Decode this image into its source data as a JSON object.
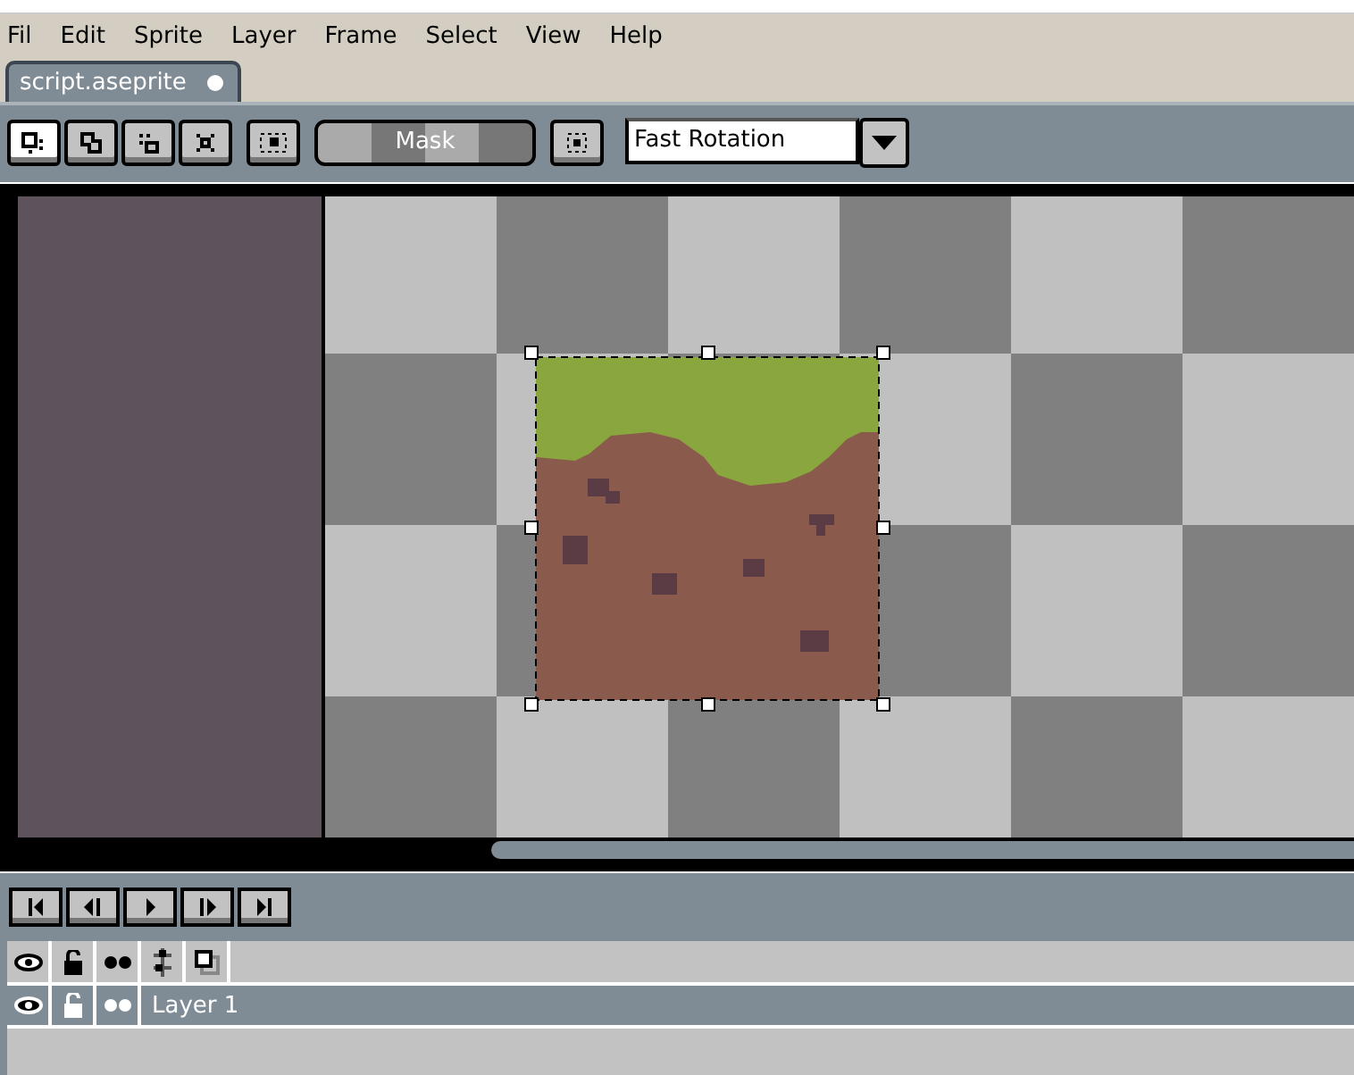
{
  "menu": [
    {
      "label": "Fil"
    },
    {
      "label": "Edit"
    },
    {
      "label": "Sprite"
    },
    {
      "label": "Layer"
    },
    {
      "label": "Frame"
    },
    {
      "label": "Select"
    },
    {
      "label": "View"
    },
    {
      "label": "Help"
    }
  ],
  "tabs": [
    {
      "label": "script.aseprite",
      "modified": true,
      "selected": true
    }
  ],
  "toolbar": {
    "selection_modes": [
      {
        "kind": "replace",
        "selected": true
      },
      {
        "kind": "add",
        "selected": false
      },
      {
        "kind": "subtract",
        "selected": false
      },
      {
        "kind": "intersect",
        "selected": false
      }
    ],
    "mask_button": "Mask",
    "rotation": "Fast Rotation"
  },
  "playback": [
    {
      "kind": "first"
    },
    {
      "kind": "prev"
    },
    {
      "kind": "play"
    },
    {
      "kind": "next"
    },
    {
      "kind": "last"
    }
  ],
  "layers": [
    {
      "name": "Layer 1",
      "visible": true,
      "locked": false,
      "selected": true
    }
  ]
}
